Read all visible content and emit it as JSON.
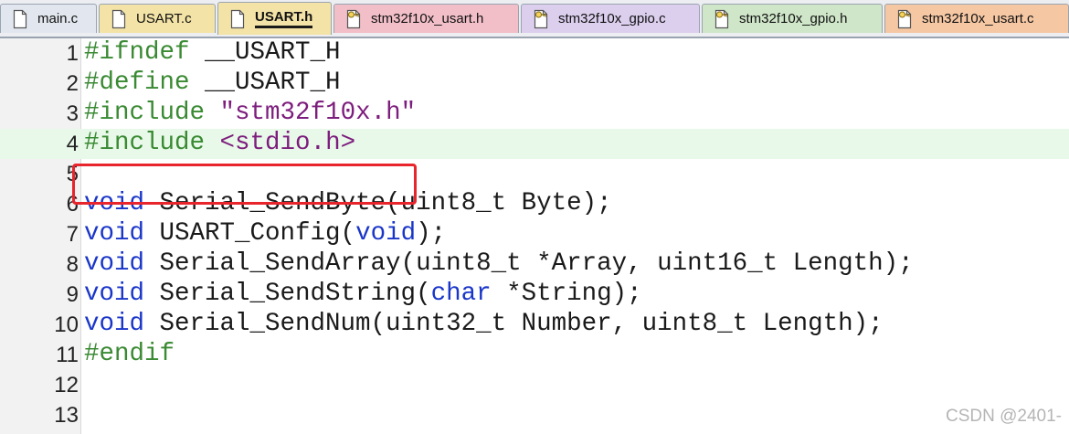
{
  "tabs": [
    {
      "label": "main.c",
      "color": "#e2e7ef",
      "icon": "file-icon",
      "active": false
    },
    {
      "label": "USART.c",
      "color": "#f3e3a6",
      "icon": "file-icon",
      "active": false
    },
    {
      "label": "USART.h",
      "color": "#f3e3a6",
      "icon": "file-icon",
      "active": true
    },
    {
      "label": "stm32f10x_usart.h",
      "color": "#f2bfc8",
      "icon": "key-file-icon",
      "active": false
    },
    {
      "label": "stm32f10x_gpio.c",
      "color": "#dccfee",
      "icon": "key-file-icon",
      "active": false
    },
    {
      "label": "stm32f10x_gpio.h",
      "color": "#cfe6c9",
      "icon": "key-file-icon",
      "active": false
    },
    {
      "label": "stm32f10x_usart.c",
      "color": "#f5c7a3",
      "icon": "key-file-icon",
      "active": false
    }
  ],
  "editor": {
    "current_line": 4,
    "highlight_box_line": 4,
    "lines": [
      {
        "n": "1",
        "tokens": [
          [
            "pp",
            "#ifndef"
          ],
          [
            "plain",
            " __USART_H"
          ]
        ]
      },
      {
        "n": "2",
        "tokens": [
          [
            "pp",
            "#define"
          ],
          [
            "plain",
            " __USART_H"
          ]
        ]
      },
      {
        "n": "3",
        "tokens": [
          [
            "pp",
            "#include"
          ],
          [
            "plain",
            " "
          ],
          [
            "str",
            "\"stm32f10x.h\""
          ]
        ]
      },
      {
        "n": "4",
        "tokens": [
          [
            "pp",
            "#include"
          ],
          [
            "plain",
            " "
          ],
          [
            "str",
            "<stdio.h>"
          ]
        ]
      },
      {
        "n": "5",
        "tokens": []
      },
      {
        "n": "6",
        "tokens": [
          [
            "kw",
            "void"
          ],
          [
            "plain",
            " Serial_SendByte(uint8_t Byte);"
          ]
        ]
      },
      {
        "n": "7",
        "tokens": [
          [
            "kw",
            "void"
          ],
          [
            "plain",
            " USART_Config("
          ],
          [
            "kw",
            "void"
          ],
          [
            "plain",
            ");"
          ]
        ]
      },
      {
        "n": "8",
        "tokens": [
          [
            "kw",
            "void"
          ],
          [
            "plain",
            " Serial_SendArray(uint8_t *Array, uint16_t Length);"
          ]
        ]
      },
      {
        "n": "9",
        "tokens": [
          [
            "kw",
            "void"
          ],
          [
            "plain",
            " Serial_SendString("
          ],
          [
            "kw",
            "char"
          ],
          [
            "plain",
            " *String);"
          ]
        ]
      },
      {
        "n": "10",
        "tokens": [
          [
            "kw",
            "void"
          ],
          [
            "plain",
            " Serial_SendNum(uint32_t Number, uint8_t Length);"
          ]
        ]
      },
      {
        "n": "11",
        "tokens": [
          [
            "pp",
            "#endif"
          ]
        ]
      },
      {
        "n": "12",
        "tokens": []
      },
      {
        "n": "13",
        "tokens": []
      }
    ]
  },
  "colors": {
    "preprocessor": "#3a8a33",
    "string": "#7d1d7d",
    "keyword": "#1a36c9",
    "current_line_bg": "#e8f9e9",
    "highlight_box": "#e8242c"
  },
  "watermark": "CSDN @2401-"
}
